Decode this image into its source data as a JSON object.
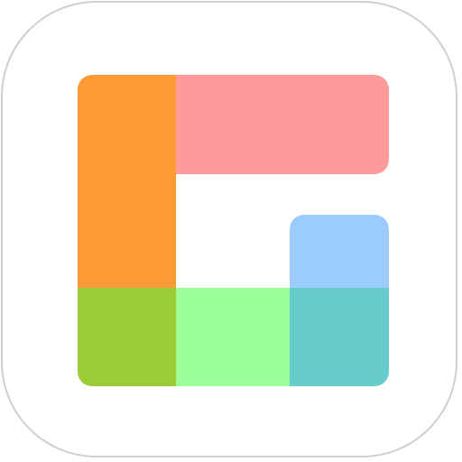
{
  "icon": {
    "name": "grid-blocks-app-icon",
    "frame_border_color": "#cfcfcf",
    "background_color": "#ffffff",
    "blocks": [
      {
        "name": "orange-block",
        "color": "#ff9a36"
      },
      {
        "name": "pink-block",
        "color": "#ff9a9a"
      },
      {
        "name": "blue-block",
        "color": "#9ccbff"
      },
      {
        "name": "olive-block",
        "color": "#9bcb36"
      },
      {
        "name": "mint-block",
        "color": "#9cff9a"
      },
      {
        "name": "teal-block",
        "color": "#66cccc"
      }
    ]
  }
}
